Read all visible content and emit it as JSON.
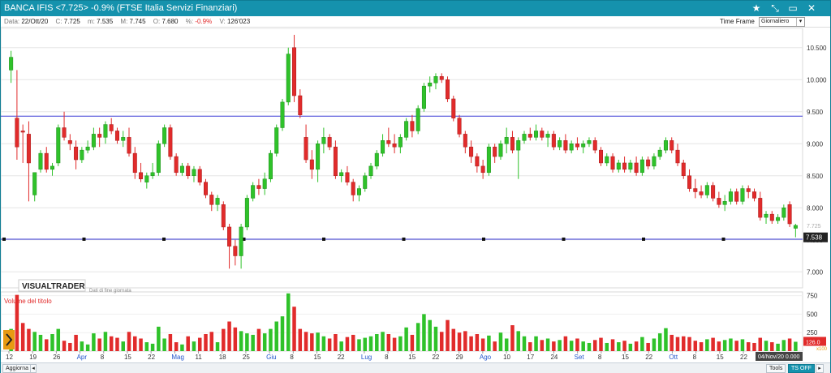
{
  "window": {
    "title": "BANCA IFIS <7.725>  -0.9%   (FTSE Italia Servizi Finanziari)",
    "controls": [
      "star-icon",
      "expand-icon",
      "restore-icon",
      "close-icon"
    ]
  },
  "info": {
    "data_label": "Data:",
    "data_value": "22/Ott/20",
    "c_label": "C:",
    "c_value": "7.725",
    "m_label": "m:",
    "m_value": "7.535",
    "M_label": "M:",
    "M_value": "7.745",
    "o_label": "O:",
    "o_value": "7.680",
    "pct_label": "%:",
    "pct_value": "-0.9%",
    "v_label": "V:",
    "v_value": "126'023"
  },
  "timeframe": {
    "label": "Time Frame",
    "selected": "Giornaliero"
  },
  "brand": {
    "name": "VISUALTRADER",
    "note": "Dati di fine giornata"
  },
  "volume_panel": {
    "label": "Volume del titolo",
    "ticks": [
      "750",
      "500",
      "250"
    ],
    "corner_tag": "x100",
    "value_tag": "126.0"
  },
  "price_axis": {
    "ticks": [
      "10.500",
      "10.000",
      "9.500",
      "9.000",
      "8.500",
      "8.000",
      "7.500",
      "7.000"
    ],
    "current_tag": "7.538",
    "ghost_tag": "7.725"
  },
  "date_axis": {
    "labels": [
      {
        "t": "12",
        "month": false
      },
      {
        "t": "19",
        "month": false
      },
      {
        "t": "26",
        "month": false
      },
      {
        "t": "Apr",
        "month": true
      },
      {
        "t": "8",
        "month": false
      },
      {
        "t": "15",
        "month": false
      },
      {
        "t": "22",
        "month": false
      },
      {
        "t": "Mag",
        "month": true
      },
      {
        "t": "11",
        "month": false
      },
      {
        "t": "18",
        "month": false
      },
      {
        "t": "25",
        "month": false
      },
      {
        "t": "Giu",
        "month": true
      },
      {
        "t": "8",
        "month": false
      },
      {
        "t": "15",
        "month": false
      },
      {
        "t": "22",
        "month": false
      },
      {
        "t": "Lug",
        "month": true
      },
      {
        "t": "8",
        "month": false
      },
      {
        "t": "15",
        "month": false
      },
      {
        "t": "22",
        "month": false
      },
      {
        "t": "29",
        "month": false
      },
      {
        "t": "Ago",
        "month": true
      },
      {
        "t": "10",
        "month": false
      },
      {
        "t": "17",
        "month": false
      },
      {
        "t": "24",
        "month": false
      },
      {
        "t": "Set",
        "month": true
      },
      {
        "t": "8",
        "month": false
      },
      {
        "t": "15",
        "month": false
      },
      {
        "t": "22",
        "month": false
      },
      {
        "t": "Ott",
        "month": true
      },
      {
        "t": "8",
        "month": false
      },
      {
        "t": "15",
        "month": false
      },
      {
        "t": "22",
        "month": false
      }
    ],
    "cursor_date": "04/Nov/20 0.000"
  },
  "hlines": [
    9.43,
    7.51
  ],
  "bottombar": {
    "aggiorna": "Aggiorna",
    "tools": "Tools",
    "ts_off": "TS OFF"
  },
  "colors": {
    "up": "#2fc22a",
    "down": "#e12b2b",
    "title_bg": "#1592ad",
    "hline": "#3b3bd6",
    "month": "#2255cc"
  },
  "chart_data": {
    "type": "candlestick",
    "title": "BANCA IFIS",
    "ylim": [
      6.75,
      10.75
    ],
    "volume_ylim": [
      0,
      800
    ],
    "candles": [
      {
        "o": 10.15,
        "h": 10.45,
        "l": 9.95,
        "c": 10.35,
        "v": 300
      },
      {
        "o": 9.4,
        "h": 10.15,
        "l": 8.75,
        "c": 8.95,
        "v": 760
      },
      {
        "o": 9.2,
        "h": 9.3,
        "l": 8.7,
        "c": 9.18,
        "v": 380
      },
      {
        "o": 9.15,
        "h": 9.35,
        "l": 8.1,
        "c": 8.7,
        "v": 300
      },
      {
        "o": 8.2,
        "h": 8.55,
        "l": 8.1,
        "c": 8.55,
        "v": 260
      },
      {
        "o": 8.6,
        "h": 8.9,
        "l": 8.55,
        "c": 8.85,
        "v": 220
      },
      {
        "o": 8.85,
        "h": 8.95,
        "l": 8.55,
        "c": 8.6,
        "v": 160
      },
      {
        "o": 8.6,
        "h": 8.7,
        "l": 8.5,
        "c": 8.65,
        "v": 230
      },
      {
        "o": 8.7,
        "h": 9.3,
        "l": 8.65,
        "c": 9.25,
        "v": 300
      },
      {
        "o": 9.25,
        "h": 9.5,
        "l": 9.05,
        "c": 9.1,
        "v": 140
      },
      {
        "o": 9.05,
        "h": 9.15,
        "l": 8.9,
        "c": 9.0,
        "v": 110
      },
      {
        "o": 8.95,
        "h": 9.05,
        "l": 8.6,
        "c": 8.75,
        "v": 220
      },
      {
        "o": 8.75,
        "h": 8.95,
        "l": 8.7,
        "c": 8.9,
        "v": 130
      },
      {
        "o": 8.9,
        "h": 9.05,
        "l": 8.85,
        "c": 8.95,
        "v": 90
      },
      {
        "o": 8.95,
        "h": 9.25,
        "l": 8.9,
        "c": 9.15,
        "v": 240
      },
      {
        "o": 9.15,
        "h": 9.25,
        "l": 8.95,
        "c": 9.1,
        "v": 170
      },
      {
        "o": 9.1,
        "h": 9.35,
        "l": 9.0,
        "c": 9.3,
        "v": 260
      },
      {
        "o": 9.3,
        "h": 9.4,
        "l": 9.15,
        "c": 9.2,
        "v": 200
      },
      {
        "o": 9.2,
        "h": 9.25,
        "l": 9.0,
        "c": 9.05,
        "v": 180
      },
      {
        "o": 9.05,
        "h": 9.2,
        "l": 8.95,
        "c": 9.1,
        "v": 130
      },
      {
        "o": 9.1,
        "h": 9.25,
        "l": 8.8,
        "c": 8.85,
        "v": 260
      },
      {
        "o": 8.85,
        "h": 8.95,
        "l": 8.45,
        "c": 8.55,
        "v": 200
      },
      {
        "o": 8.55,
        "h": 8.7,
        "l": 8.4,
        "c": 8.45,
        "v": 170
      },
      {
        "o": 8.4,
        "h": 8.55,
        "l": 8.3,
        "c": 8.5,
        "v": 120
      },
      {
        "o": 8.5,
        "h": 8.7,
        "l": 8.45,
        "c": 8.55,
        "v": 100
      },
      {
        "o": 8.55,
        "h": 9.05,
        "l": 8.5,
        "c": 9.0,
        "v": 330
      },
      {
        "o": 9.0,
        "h": 9.3,
        "l": 8.95,
        "c": 9.25,
        "v": 170
      },
      {
        "o": 9.25,
        "h": 9.3,
        "l": 8.75,
        "c": 8.8,
        "v": 230
      },
      {
        "o": 8.8,
        "h": 8.85,
        "l": 8.5,
        "c": 8.55,
        "v": 120
      },
      {
        "o": 8.55,
        "h": 8.7,
        "l": 8.5,
        "c": 8.65,
        "v": 90
      },
      {
        "o": 8.65,
        "h": 8.7,
        "l": 8.45,
        "c": 8.5,
        "v": 200
      },
      {
        "o": 8.5,
        "h": 8.65,
        "l": 8.4,
        "c": 8.6,
        "v": 130
      },
      {
        "o": 8.6,
        "h": 8.65,
        "l": 8.35,
        "c": 8.4,
        "v": 180
      },
      {
        "o": 8.4,
        "h": 8.45,
        "l": 8.15,
        "c": 8.2,
        "v": 230
      },
      {
        "o": 8.2,
        "h": 8.25,
        "l": 7.95,
        "c": 8.05,
        "v": 260
      },
      {
        "o": 8.05,
        "h": 8.2,
        "l": 7.95,
        "c": 8.15,
        "v": 120
      },
      {
        "o": 8.05,
        "h": 8.1,
        "l": 7.65,
        "c": 7.7,
        "v": 300
      },
      {
        "o": 7.7,
        "h": 7.75,
        "l": 7.05,
        "c": 7.4,
        "v": 400
      },
      {
        "o": 7.4,
        "h": 7.5,
        "l": 7.1,
        "c": 7.25,
        "v": 320
      },
      {
        "o": 7.25,
        "h": 7.75,
        "l": 7.05,
        "c": 7.7,
        "v": 270
      },
      {
        "o": 7.7,
        "h": 8.2,
        "l": 7.65,
        "c": 8.15,
        "v": 240
      },
      {
        "o": 8.15,
        "h": 8.4,
        "l": 8.1,
        "c": 8.35,
        "v": 220
      },
      {
        "o": 8.35,
        "h": 8.45,
        "l": 8.2,
        "c": 8.3,
        "v": 300
      },
      {
        "o": 8.3,
        "h": 8.55,
        "l": 8.2,
        "c": 8.45,
        "v": 240
      },
      {
        "o": 8.45,
        "h": 8.9,
        "l": 8.4,
        "c": 8.85,
        "v": 300
      },
      {
        "o": 8.85,
        "h": 9.3,
        "l": 8.8,
        "c": 9.25,
        "v": 400
      },
      {
        "o": 9.25,
        "h": 9.7,
        "l": 9.2,
        "c": 9.65,
        "v": 470
      },
      {
        "o": 9.65,
        "h": 10.5,
        "l": 9.6,
        "c": 10.4,
        "v": 780
      },
      {
        "o": 10.5,
        "h": 10.7,
        "l": 9.65,
        "c": 9.75,
        "v": 600
      },
      {
        "o": 9.75,
        "h": 9.85,
        "l": 9.4,
        "c": 9.45,
        "v": 300
      },
      {
        "o": 9.1,
        "h": 9.3,
        "l": 8.7,
        "c": 8.75,
        "v": 260
      },
      {
        "o": 8.75,
        "h": 8.9,
        "l": 8.45,
        "c": 8.6,
        "v": 240
      },
      {
        "o": 8.6,
        "h": 9.05,
        "l": 8.4,
        "c": 9.0,
        "v": 250
      },
      {
        "o": 9.0,
        "h": 9.25,
        "l": 8.85,
        "c": 9.1,
        "v": 200
      },
      {
        "o": 9.1,
        "h": 9.15,
        "l": 8.9,
        "c": 8.95,
        "v": 170
      },
      {
        "o": 8.95,
        "h": 9.05,
        "l": 8.45,
        "c": 8.5,
        "v": 230
      },
      {
        "o": 8.5,
        "h": 8.6,
        "l": 8.4,
        "c": 8.55,
        "v": 130
      },
      {
        "o": 8.55,
        "h": 8.65,
        "l": 8.35,
        "c": 8.4,
        "v": 190
      },
      {
        "o": 8.4,
        "h": 8.45,
        "l": 8.1,
        "c": 8.2,
        "v": 220
      },
      {
        "o": 8.2,
        "h": 8.35,
        "l": 8.1,
        "c": 8.3,
        "v": 160
      },
      {
        "o": 8.3,
        "h": 8.55,
        "l": 8.25,
        "c": 8.5,
        "v": 180
      },
      {
        "o": 8.5,
        "h": 8.7,
        "l": 8.45,
        "c": 8.65,
        "v": 200
      },
      {
        "o": 8.65,
        "h": 8.9,
        "l": 8.6,
        "c": 8.85,
        "v": 230
      },
      {
        "o": 8.85,
        "h": 9.15,
        "l": 8.8,
        "c": 9.05,
        "v": 260
      },
      {
        "o": 9.05,
        "h": 9.25,
        "l": 8.95,
        "c": 9.0,
        "v": 230
      },
      {
        "o": 9.0,
        "h": 9.15,
        "l": 8.85,
        "c": 8.95,
        "v": 180
      },
      {
        "o": 8.95,
        "h": 9.15,
        "l": 8.85,
        "c": 9.1,
        "v": 200
      },
      {
        "o": 9.1,
        "h": 9.4,
        "l": 9.05,
        "c": 9.35,
        "v": 320
      },
      {
        "o": 9.35,
        "h": 9.45,
        "l": 9.1,
        "c": 9.2,
        "v": 220
      },
      {
        "o": 9.2,
        "h": 9.6,
        "l": 9.15,
        "c": 9.55,
        "v": 380
      },
      {
        "o": 9.55,
        "h": 9.95,
        "l": 9.5,
        "c": 9.9,
        "v": 500
      },
      {
        "o": 9.9,
        "h": 10.05,
        "l": 9.8,
        "c": 9.95,
        "v": 420
      },
      {
        "o": 9.95,
        "h": 10.1,
        "l": 9.85,
        "c": 10.05,
        "v": 330
      },
      {
        "o": 10.05,
        "h": 10.1,
        "l": 9.95,
        "c": 10.0,
        "v": 260
      },
      {
        "o": 10.0,
        "h": 10.05,
        "l": 9.65,
        "c": 9.7,
        "v": 420
      },
      {
        "o": 9.7,
        "h": 9.75,
        "l": 9.35,
        "c": 9.4,
        "v": 300
      },
      {
        "o": 9.4,
        "h": 9.45,
        "l": 9.1,
        "c": 9.15,
        "v": 250
      },
      {
        "o": 9.15,
        "h": 9.2,
        "l": 8.85,
        "c": 8.95,
        "v": 270
      },
      {
        "o": 8.95,
        "h": 9.05,
        "l": 8.7,
        "c": 8.8,
        "v": 200
      },
      {
        "o": 8.8,
        "h": 8.85,
        "l": 8.55,
        "c": 8.65,
        "v": 230
      },
      {
        "o": 8.65,
        "h": 8.75,
        "l": 8.45,
        "c": 8.55,
        "v": 170
      },
      {
        "o": 8.55,
        "h": 9.0,
        "l": 8.5,
        "c": 8.95,
        "v": 210
      },
      {
        "o": 8.95,
        "h": 9.0,
        "l": 8.7,
        "c": 8.8,
        "v": 130
      },
      {
        "o": 8.8,
        "h": 9.05,
        "l": 8.75,
        "c": 9.0,
        "v": 250
      },
      {
        "o": 9.0,
        "h": 9.25,
        "l": 8.85,
        "c": 9.1,
        "v": 170
      },
      {
        "o": 9.1,
        "h": 9.2,
        "l": 8.85,
        "c": 8.9,
        "v": 350
      },
      {
        "o": 8.9,
        "h": 9.1,
        "l": 8.45,
        "c": 9.05,
        "v": 270
      },
      {
        "o": 9.05,
        "h": 9.2,
        "l": 9.0,
        "c": 9.15,
        "v": 200
      },
      {
        "o": 9.15,
        "h": 9.25,
        "l": 9.05,
        "c": 9.1,
        "v": 120
      },
      {
        "o": 9.1,
        "h": 9.3,
        "l": 9.05,
        "c": 9.2,
        "v": 200
      },
      {
        "o": 9.2,
        "h": 9.25,
        "l": 9.05,
        "c": 9.1,
        "v": 150
      },
      {
        "o": 9.1,
        "h": 9.2,
        "l": 8.95,
        "c": 9.15,
        "v": 170
      },
      {
        "o": 9.15,
        "h": 9.2,
        "l": 8.9,
        "c": 8.95,
        "v": 130
      },
      {
        "o": 8.95,
        "h": 9.1,
        "l": 8.9,
        "c": 9.05,
        "v": 150
      },
      {
        "o": 9.05,
        "h": 9.15,
        "l": 8.85,
        "c": 8.9,
        "v": 200
      },
      {
        "o": 8.9,
        "h": 9.05,
        "l": 8.85,
        "c": 9.0,
        "v": 140
      },
      {
        "o": 9.0,
        "h": 9.1,
        "l": 8.9,
        "c": 8.95,
        "v": 170
      },
      {
        "o": 8.95,
        "h": 9.05,
        "l": 8.85,
        "c": 9.0,
        "v": 130
      },
      {
        "o": 9.0,
        "h": 9.1,
        "l": 8.95,
        "c": 9.05,
        "v": 110
      },
      {
        "o": 9.05,
        "h": 9.1,
        "l": 8.85,
        "c": 8.9,
        "v": 150
      },
      {
        "o": 8.9,
        "h": 8.95,
        "l": 8.65,
        "c": 8.7,
        "v": 180
      },
      {
        "o": 8.7,
        "h": 8.85,
        "l": 8.65,
        "c": 8.8,
        "v": 110
      },
      {
        "o": 8.8,
        "h": 8.85,
        "l": 8.55,
        "c": 8.6,
        "v": 160
      },
      {
        "o": 8.6,
        "h": 8.75,
        "l": 8.55,
        "c": 8.7,
        "v": 120
      },
      {
        "o": 8.7,
        "h": 8.8,
        "l": 8.55,
        "c": 8.6,
        "v": 140
      },
      {
        "o": 8.6,
        "h": 8.75,
        "l": 8.55,
        "c": 8.7,
        "v": 100
      },
      {
        "o": 8.7,
        "h": 8.8,
        "l": 8.5,
        "c": 8.55,
        "v": 130
      },
      {
        "o": 8.55,
        "h": 8.8,
        "l": 8.5,
        "c": 8.75,
        "v": 190
      },
      {
        "o": 8.75,
        "h": 8.8,
        "l": 8.6,
        "c": 8.65,
        "v": 110
      },
      {
        "o": 8.65,
        "h": 8.85,
        "l": 8.6,
        "c": 8.8,
        "v": 170
      },
      {
        "o": 8.8,
        "h": 8.95,
        "l": 8.75,
        "c": 8.9,
        "v": 240
      },
      {
        "o": 8.9,
        "h": 9.1,
        "l": 8.85,
        "c": 9.05,
        "v": 310
      },
      {
        "o": 9.05,
        "h": 9.1,
        "l": 8.85,
        "c": 8.9,
        "v": 220
      },
      {
        "o": 8.9,
        "h": 9.0,
        "l": 8.65,
        "c": 8.7,
        "v": 190
      },
      {
        "o": 8.7,
        "h": 8.75,
        "l": 8.45,
        "c": 8.5,
        "v": 200
      },
      {
        "o": 8.5,
        "h": 8.6,
        "l": 8.25,
        "c": 8.3,
        "v": 190
      },
      {
        "o": 8.3,
        "h": 8.45,
        "l": 8.15,
        "c": 8.25,
        "v": 140
      },
      {
        "o": 8.25,
        "h": 8.35,
        "l": 8.15,
        "c": 8.2,
        "v": 120
      },
      {
        "o": 8.2,
        "h": 8.4,
        "l": 8.15,
        "c": 8.35,
        "v": 160
      },
      {
        "o": 8.35,
        "h": 8.4,
        "l": 8.1,
        "c": 8.15,
        "v": 180
      },
      {
        "o": 8.15,
        "h": 8.25,
        "l": 8.0,
        "c": 8.05,
        "v": 130
      },
      {
        "o": 8.05,
        "h": 8.2,
        "l": 7.95,
        "c": 8.1,
        "v": 150
      },
      {
        "o": 8.1,
        "h": 8.3,
        "l": 8.05,
        "c": 8.25,
        "v": 170
      },
      {
        "o": 8.25,
        "h": 8.3,
        "l": 8.05,
        "c": 8.1,
        "v": 140
      },
      {
        "o": 8.1,
        "h": 8.35,
        "l": 8.05,
        "c": 8.3,
        "v": 160
      },
      {
        "o": 8.3,
        "h": 8.35,
        "l": 8.15,
        "c": 8.25,
        "v": 120
      },
      {
        "o": 8.25,
        "h": 8.3,
        "l": 8.1,
        "c": 8.15,
        "v": 110
      },
      {
        "o": 8.15,
        "h": 8.25,
        "l": 7.8,
        "c": 7.85,
        "v": 180
      },
      {
        "o": 7.85,
        "h": 7.95,
        "l": 7.75,
        "c": 7.9,
        "v": 140
      },
      {
        "o": 7.9,
        "h": 7.95,
        "l": 7.75,
        "c": 7.8,
        "v": 120
      },
      {
        "o": 7.8,
        "h": 7.9,
        "l": 7.75,
        "c": 7.85,
        "v": 100
      },
      {
        "o": 7.85,
        "h": 8.05,
        "l": 7.8,
        "c": 8.0,
        "v": 150
      },
      {
        "o": 8.05,
        "h": 8.1,
        "l": 7.7,
        "c": 7.75,
        "v": 170
      },
      {
        "o": 7.68,
        "h": 7.75,
        "l": 7.54,
        "c": 7.725,
        "v": 126
      }
    ]
  }
}
